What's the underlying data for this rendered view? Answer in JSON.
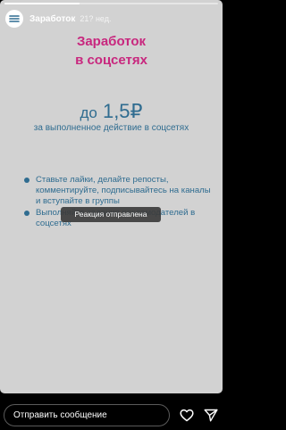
{
  "story": {
    "progress": 0.35,
    "account_name": "Заработок",
    "posted_ago": "21? нед."
  },
  "content": {
    "headline_line1": "Заработок",
    "headline_line2": "в соцсетях",
    "price_prefix": "до",
    "price_value": "1,5₽",
    "price_caption": "за выполненное действие в соцсетях",
    "bullets": [
      "Ставьте лайки, делайте репосты, комментируйте, подписывайтесь на каналы и вступайте в группы",
      "Выполняйте задания рекламодателей в соцсетях"
    ]
  },
  "toast": {
    "text": "Реакция отправлена"
  },
  "reply": {
    "placeholder": "Отправить сообщение"
  },
  "icons": {
    "like": "heart-icon",
    "share": "send-icon"
  },
  "colors": {
    "headline": "#c8277e",
    "body_text": "#2f6c90",
    "card_background": "#d2d2d2"
  }
}
